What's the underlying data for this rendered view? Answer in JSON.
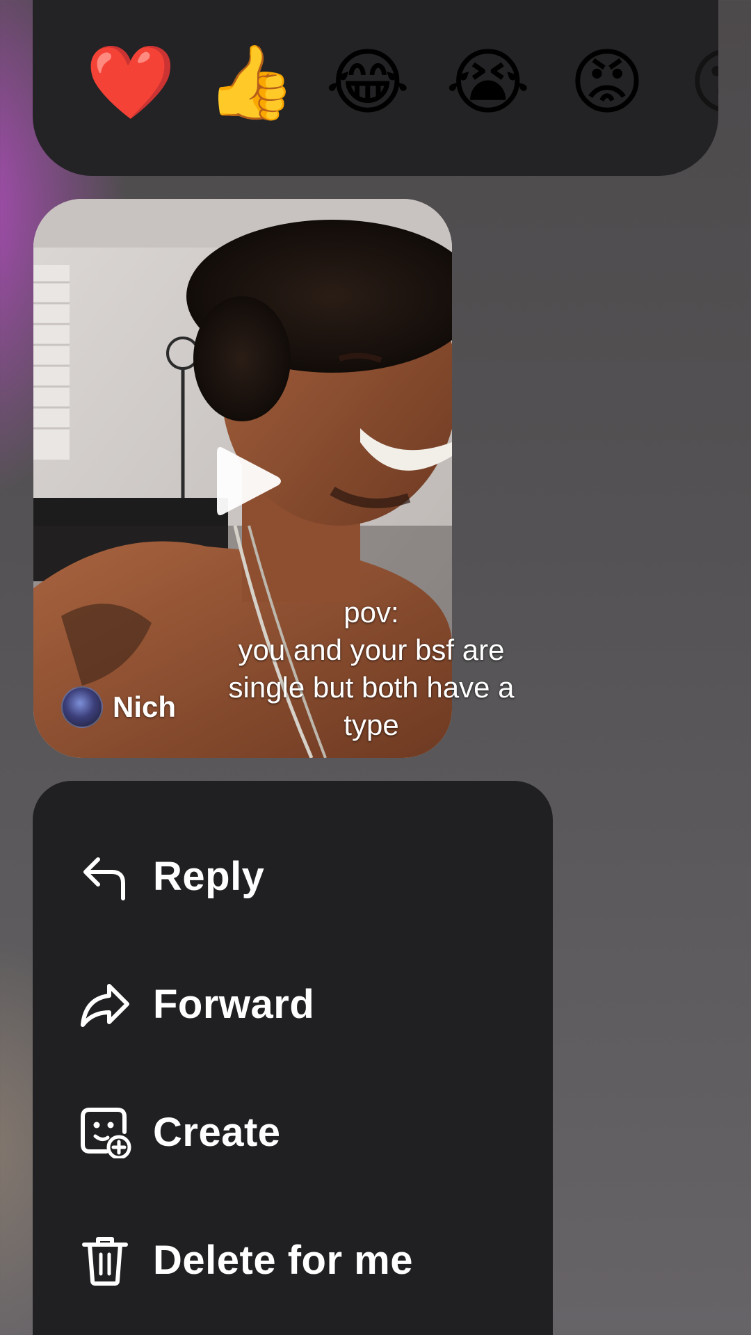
{
  "reactions": {
    "items": [
      {
        "emoji": "❤️",
        "name": "heart"
      },
      {
        "emoji": "👍",
        "name": "thumbs-up"
      },
      {
        "emoji": "😂",
        "name": "laughing"
      },
      {
        "emoji": "😭",
        "name": "crying"
      },
      {
        "emoji": "😡",
        "name": "angry"
      },
      {
        "emoji": "😮",
        "name": "partial-emoji"
      }
    ]
  },
  "video": {
    "caption_lines": [
      "pov:",
      "you and your bsf are",
      "single but both have a",
      "type"
    ],
    "author_name": "Nich"
  },
  "menu": {
    "reply_label": "Reply",
    "forward_label": "Forward",
    "create_label": "Create",
    "delete_label": "Delete for me"
  },
  "colors": {
    "menu_bg": "#202022",
    "reaction_bar_bg": "#232325",
    "accent_purple": "#ba4bc8"
  }
}
